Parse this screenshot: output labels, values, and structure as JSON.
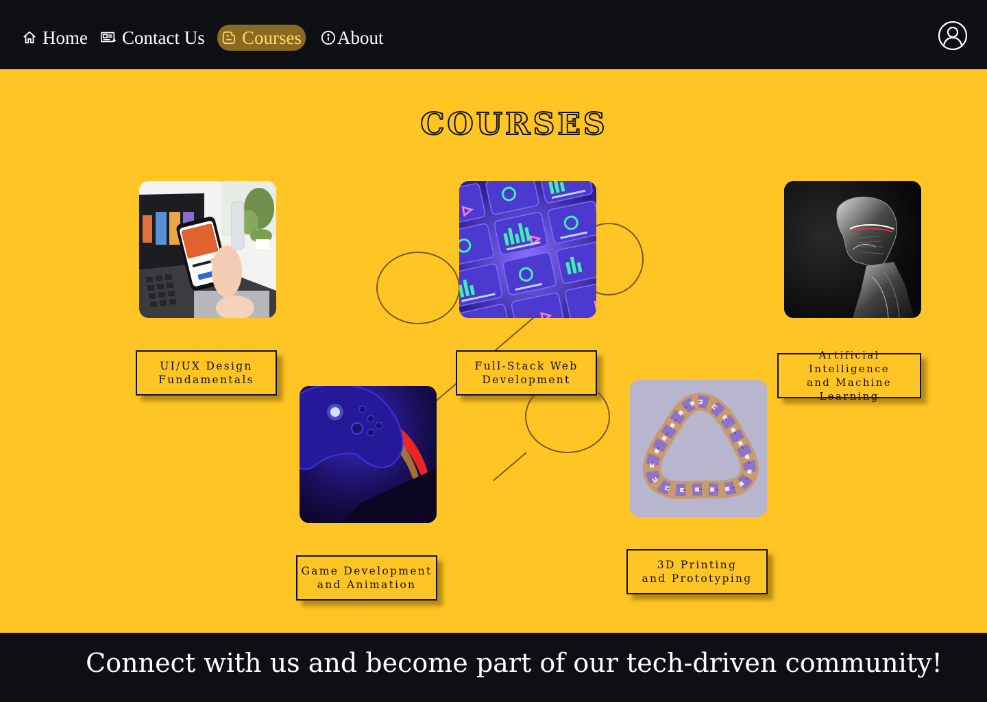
{
  "nav": {
    "items": [
      {
        "label": "Home",
        "icon": "home-icon"
      },
      {
        "label": "Contact Us",
        "icon": "contact-card-icon"
      },
      {
        "label": "Courses",
        "icon": "blogger-icon",
        "active": true
      },
      {
        "label": "About",
        "icon": "info-icon"
      }
    ],
    "user_icon": "user-icon"
  },
  "colors": {
    "page_background": "#ffc525",
    "header_background": "#0e0f13",
    "active_nav_background": "#8a6a22",
    "active_nav_text": "#ffd86a"
  },
  "main": {
    "title": "COURSES",
    "courses": [
      {
        "line1": "UI/UX Design",
        "line2": "Fundamentals",
        "image": "laptop-and-phone-photo"
      },
      {
        "line1": "Full-Stack Web",
        "line2": "Development",
        "image": "dashboard-tiles-photo"
      },
      {
        "line1": "Artificial Intelligence",
        "line2": "and Machine Learning",
        "image": "robot-head-photo"
      },
      {
        "line1": "Game Development",
        "line2": "and Animation",
        "image": "game-controller-photo"
      },
      {
        "line1": "3D Printing",
        "line2": "and Prototyping",
        "image": "twisted-ring-photo"
      }
    ]
  },
  "footer": {
    "text": "Connect with us and become part of our tech-driven community!"
  }
}
